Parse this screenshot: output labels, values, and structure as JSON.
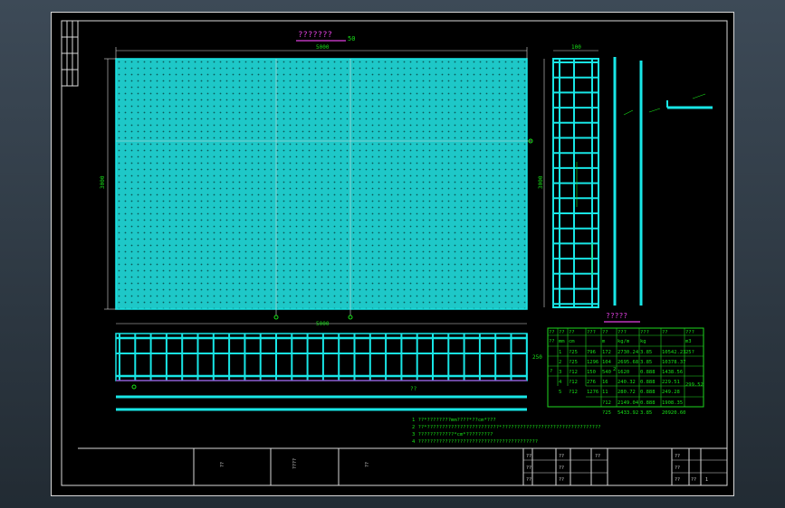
{
  "drawing": {
    "plan_title": "???????",
    "plan_scale": "50",
    "table_title": "?????",
    "notes_heading": "??",
    "notes": [
      "1 ??*????????mm????*??cm*???",
      "2 ??*????????????????????????*?????????????????????????????????",
      "3 ????????????*cm*?????????",
      "4 ????????????????????????????????????????"
    ],
    "dimensions": {
      "plan_width": "5000",
      "plan_height": "3000",
      "bar_spacing": "25",
      "side_height": "250",
      "section_width": "100"
    }
  },
  "quantity_table": {
    "header_row1": [
      "??",
      "??",
      "??",
      "???",
      "??",
      "???",
      "???",
      "??",
      "???"
    ],
    "header_row2": [
      "??",
      "mm",
      "cm",
      "",
      "m",
      "kg/m",
      "kg",
      "",
      "m3"
    ],
    "group_label": "?",
    "rows": [
      [
        "1",
        "?25",
        "796",
        "172",
        "2730.24",
        "3.85",
        "10542.23",
        "25?"
      ],
      [
        "2",
        "?25",
        "1296",
        "104",
        "2695.68",
        "3.85",
        "10378.37",
        ""
      ],
      [
        "3",
        "?12",
        "150",
        "540",
        "1620",
        "0.888",
        "1438.56",
        ""
      ],
      [
        "4",
        "?12",
        "276",
        "16",
        "240.32",
        "0.888",
        "229.51",
        ""
      ],
      [
        "5",
        "?12",
        "1276",
        "11",
        "280.72",
        "0.888",
        "249.28",
        ""
      ]
    ],
    "side_mark": "2",
    "subtotals": [
      [
        "?12",
        "2149.04",
        "0.888",
        "1908.35"
      ],
      [
        "?25",
        "5433.92",
        "3.85",
        "20920.60"
      ]
    ],
    "concrete_volume": "299.52"
  },
  "title_block": {
    "cells": [
      "??",
      "??",
      "??",
      "??",
      "??",
      "??",
      "????",
      "??",
      "??",
      "??",
      "??",
      "??",
      "??",
      "??",
      "1"
    ]
  },
  "colors": {
    "line": "#18e6e6",
    "mesh": "#1ec8c8",
    "text": "#18e018",
    "accent": "#d020d0",
    "frame": "#d8d8d8",
    "table_line": "#1fd81f"
  }
}
